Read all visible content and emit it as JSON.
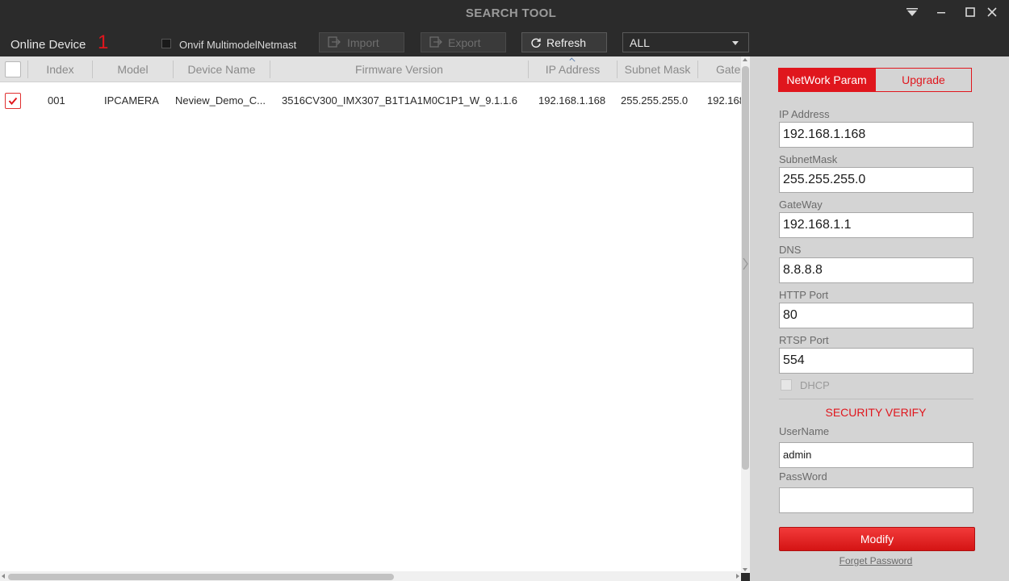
{
  "window": {
    "title": "SEARCH TOOL"
  },
  "toolbar": {
    "online_label": "Online Device",
    "online_count": "1",
    "onvif_label": "Onvif MultimodelNetmast",
    "import_label": "Import",
    "export_label": "Export",
    "refresh_label": "Refresh",
    "filter_value": "ALL"
  },
  "table": {
    "headers": {
      "index": "Index",
      "model": "Model",
      "device_name": "Device Name",
      "firmware": "Firmware Version",
      "ip": "IP Address",
      "subnet": "Subnet Mask",
      "gateway": "Gate"
    },
    "rows": [
      {
        "checked": true,
        "index": "001",
        "model": "IPCAMERA",
        "device_name": "Neview_Demo_C...",
        "firmware": "3516CV300_IMX307_B1T1A1M0C1P1_W_9.1.1.6",
        "ip": "192.168.1.168",
        "subnet": "255.255.255.0",
        "gateway": "192.168"
      }
    ]
  },
  "panel": {
    "tab_network": "NetWork Param",
    "tab_upgrade": "Upgrade",
    "ip_label": "IP Address",
    "ip_value": "192.168.1.168",
    "subnet_label": "SubnetMask",
    "subnet_value": "255.255.255.0",
    "gateway_label": "GateWay",
    "gateway_value": "192.168.1.1",
    "dns_label": "DNS",
    "dns_value": "8.8.8.8",
    "http_label": "HTTP Port",
    "http_value": "80",
    "rtsp_label": "RTSP Port",
    "rtsp_value": "554",
    "dhcp_label": "DHCP",
    "security_title": "SECURITY VERIFY",
    "username_label": "UserName",
    "username_value": "admin",
    "password_label": "PassWord",
    "password_value": "",
    "modify_label": "Modify",
    "forget_label": "Forget Password"
  },
  "colors": {
    "accent": "#e0161d",
    "titlebar": "#2b2b2b",
    "panel": "#d4d4d4"
  }
}
